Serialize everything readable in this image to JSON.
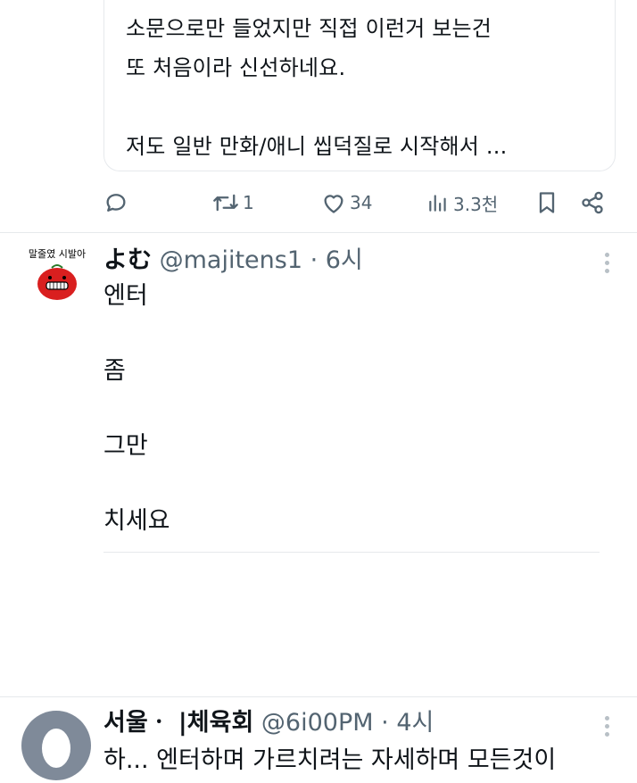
{
  "quote": {
    "text": "소문으로만 들었지만 직접 이런거 보는건\n또 처음이라 신선하네요.\n\n저도 일반 만화/애니 씹덕질로 시작해서 ..."
  },
  "actions": {
    "retweets": "1",
    "likes": "34",
    "views": "3.3천"
  },
  "tweet1": {
    "display_name": "よむ",
    "handle": "@majitens1",
    "time": "6시",
    "avatar_text": "말줄였 시발아",
    "lines": [
      "엔터",
      "좀",
      "그만",
      "치세요"
    ]
  },
  "tweet2": {
    "display_name": "서울ㆍ |체육회",
    "handle": "@6i00PM",
    "time": "4시",
    "line": "하... 엔터하며 가르치려는 자세하며 모든것이"
  },
  "colors": {
    "text": "#0f1419",
    "muted": "#536471",
    "border": "#e6e9ec",
    "avatar_red": "#d91f1f"
  }
}
